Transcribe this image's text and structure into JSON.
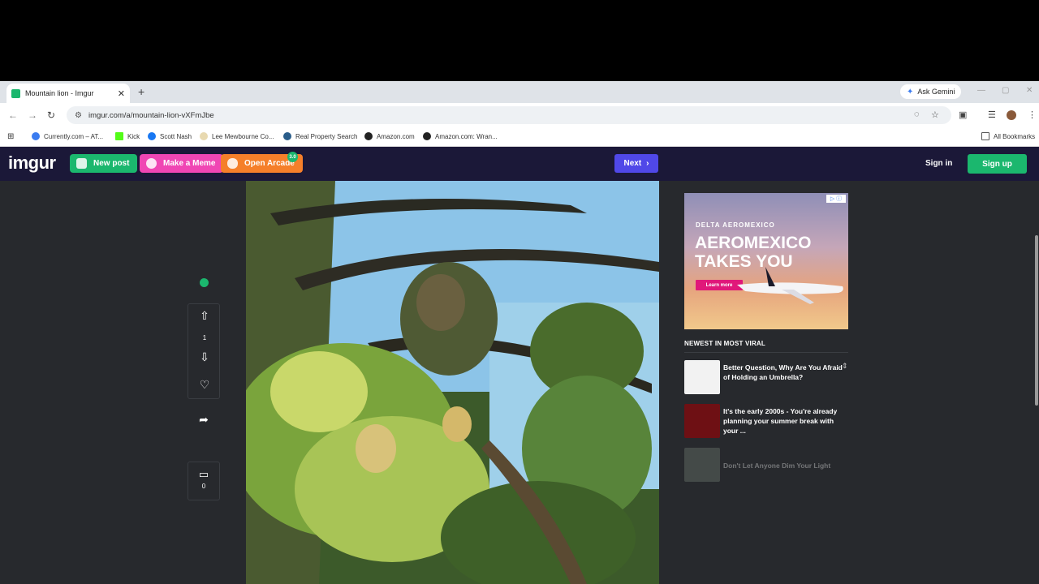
{
  "browser": {
    "tab_title": "Mountain lion - Imgur",
    "new_tab": "+",
    "gemini_label": "Ask Gemini",
    "url": "imgur.com/a/mountain-lion-vXFmJbe",
    "bookmarks": [
      "Currently.com – AT...",
      "Kick",
      "Scott Nash",
      "Lee Mewbourne Co...",
      "Real Property Search",
      "Amazon.com",
      "Amazon.com: Wran..."
    ],
    "all_bookmarks": "All Bookmarks"
  },
  "imgur": {
    "logo": "imgur",
    "new_post": "New post",
    "make_meme": "Make a Meme",
    "open_arcade": "Open Arcade",
    "arcade_badge": "3.0",
    "next": "Next",
    "sign_in": "Sign in",
    "sign_up": "Sign up"
  },
  "post": {
    "vote_count": "1",
    "comment_count": "0"
  },
  "ad": {
    "brand_line": "DELTA   AEROMEXICO",
    "headline": "AEROMEXICO TAKES YOU",
    "cta": "Learn more"
  },
  "sidebar": {
    "heading": "NEWEST IN MOST VIRAL",
    "items": [
      {
        "title": "Better Question, Why Are You Afraid of Holding an Umbrella?"
      },
      {
        "title": "It's the early 2000s - You're already planning your summer break with your ..."
      },
      {
        "title": "Don't Let Anyone Dim Your Light"
      }
    ]
  },
  "colors": {
    "imgur_nav": "#1b1838",
    "page_bg": "#27292d",
    "green": "#1bb76e",
    "pink": "#f046b4",
    "orange": "#f57f2a",
    "purple": "#5048e8"
  }
}
